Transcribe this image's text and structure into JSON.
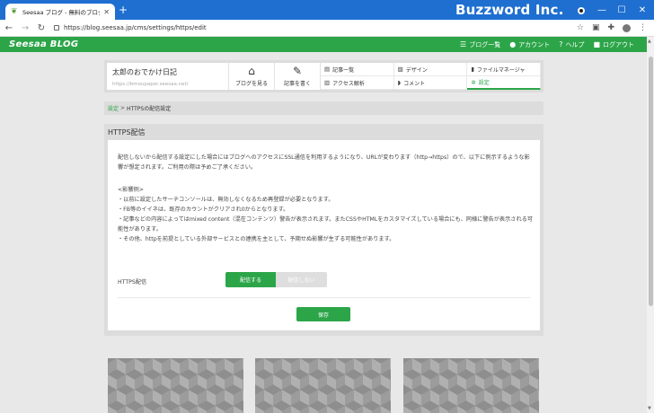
{
  "browser": {
    "tab_title": "Seesaa ブログ - 無料のブログ(blog)",
    "url": "https://blog.seesaa.jp/cms/settings/https/edit",
    "watermark": "Buzzword Inc."
  },
  "header": {
    "logo": "Seesaa BLOG",
    "nav": [
      {
        "icon": "list-icon",
        "label": "ブログ一覧"
      },
      {
        "icon": "user-icon",
        "label": "アカウント"
      },
      {
        "icon": "help-icon",
        "label": "ヘルプ"
      },
      {
        "icon": "lock-icon",
        "label": "ログアウト"
      }
    ]
  },
  "blog": {
    "name": "太郎のおでかけ日記",
    "url": "https://bmoupaper.seesaa.net/",
    "view_label": "ブログを見る",
    "write_label": "記事を書く"
  },
  "menu": [
    {
      "icon": "article-icon",
      "label": "記事一覧"
    },
    {
      "icon": "design-icon",
      "label": "デザイン"
    },
    {
      "icon": "file-icon",
      "label": "ファイルマネージャ"
    },
    {
      "icon": "chart-icon",
      "label": "アクセス解析"
    },
    {
      "icon": "comment-icon",
      "label": "コメント"
    },
    {
      "icon": "gear-icon",
      "label": "設定",
      "active": true
    }
  ],
  "breadcrumb": {
    "parent": "設定",
    "separator": ">",
    "current": "HTTPSの配信設定"
  },
  "card": {
    "title": "HTTPS配信",
    "description": "配信しないから配信する設定にした場合にはブログへのアクセスにSSL通信を利用するようになり、URLが変わります（http→https）ので、以下に例示するような影響が想定されます。ご利用の際は予めご了承ください。",
    "notes": [
      "<影響例>",
      "・以前に設定したサーチコンソールは、無効しなくなるため再登録が必要となります。",
      "・FB等のイイネは、既存のカウントがクリアされ0からとなります。",
      "・記事などの内容によってはmixed content（混在コンテンツ）警告が表示されます。またCSSやHTMLをカスタマイズしている場合にも、同様に警告が表示される可能性があります。",
      "・その他、httpを前提としている外部サービスとの連携を主として、予期せぬ影響が生ずる可能性があります。"
    ],
    "https_label": "HTTPS配信",
    "toggle_on": "配信する",
    "toggle_off": "配信しない",
    "save": "保存"
  },
  "colors": {
    "brand": "#2ca549",
    "chrome": "#1e6fd0"
  }
}
